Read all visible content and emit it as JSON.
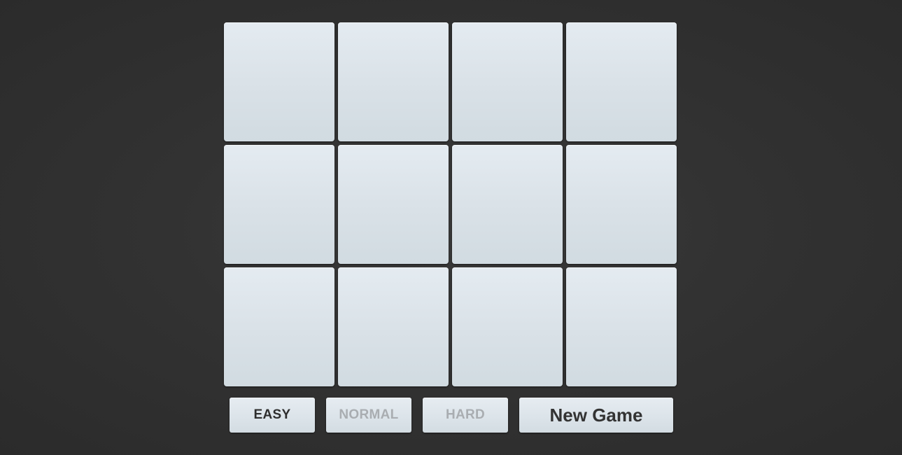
{
  "board": {
    "columns": 4,
    "rows": 3,
    "cards": [
      {
        "face": "down"
      },
      {
        "face": "down"
      },
      {
        "face": "down"
      },
      {
        "face": "down"
      },
      {
        "face": "down"
      },
      {
        "face": "down"
      },
      {
        "face": "down"
      },
      {
        "face": "down"
      },
      {
        "face": "down"
      },
      {
        "face": "down"
      },
      {
        "face": "down"
      },
      {
        "face": "down"
      }
    ]
  },
  "controls": {
    "difficulty": [
      {
        "label": "EASY",
        "active": true
      },
      {
        "label": "NORMAL",
        "active": false
      },
      {
        "label": "HARD",
        "active": false
      }
    ],
    "new_game_label": "New Game"
  },
  "colors": {
    "background": "#323232",
    "card": "#dce4ea",
    "active_text": "#2e2e2e",
    "inactive_text": "#a9adb1"
  }
}
